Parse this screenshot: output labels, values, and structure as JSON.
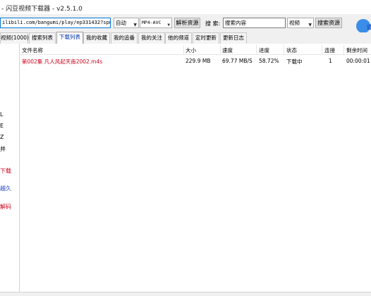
{
  "window": {
    "title": "- 闪豆视频下载器 - v2.5.1.0"
  },
  "toolbar": {
    "url_value": "ilibili.com/bangumi/play/ep331432?spm_id",
    "quality_value": "自动",
    "format_value": "MP4-AVC",
    "parse_button": "解析资源",
    "search_label": "搜 索:",
    "search_placeholder": "搜索内容",
    "search_type_value": "视频",
    "search_button": "搜索资源",
    "logo_frag": "迹"
  },
  "tabs": [
    "视频(1000)",
    "搜索列表",
    "下载列表",
    "我的收藏",
    "我的追番",
    "我的关注",
    "他的频道",
    "定时更新",
    "更新日志"
  ],
  "active_tab": 2,
  "left_fragments": [
    {
      "text": "L",
      "color": "#000000"
    },
    {
      "text": "E",
      "color": "#000000"
    },
    {
      "text": "Z",
      "color": "#000000"
    },
    {
      "text": "并",
      "color": "#000000"
    },
    {
      "text": "下载",
      "color": "#d0021b"
    },
    {
      "text": "越久",
      "color": "#1a3fc9"
    },
    {
      "text": "解码",
      "color": "#d0021b"
    }
  ],
  "table": {
    "columns": [
      "文件名称",
      "大小",
      "速度",
      "进度",
      "状态",
      "连接",
      "剩余时间"
    ],
    "rows": [
      {
        "name": "第002集 凡人风起天南2002.m4s",
        "size": "229.9 MB",
        "speed": "69.77 MB/S",
        "progress": "58.72%",
        "status": "下载中",
        "connections": "1",
        "remaining": "00:00:01"
      }
    ]
  },
  "colors": {
    "row_text": "#d0021b",
    "active_tab_text": "#0033aa",
    "accent": "#0078d7"
  }
}
